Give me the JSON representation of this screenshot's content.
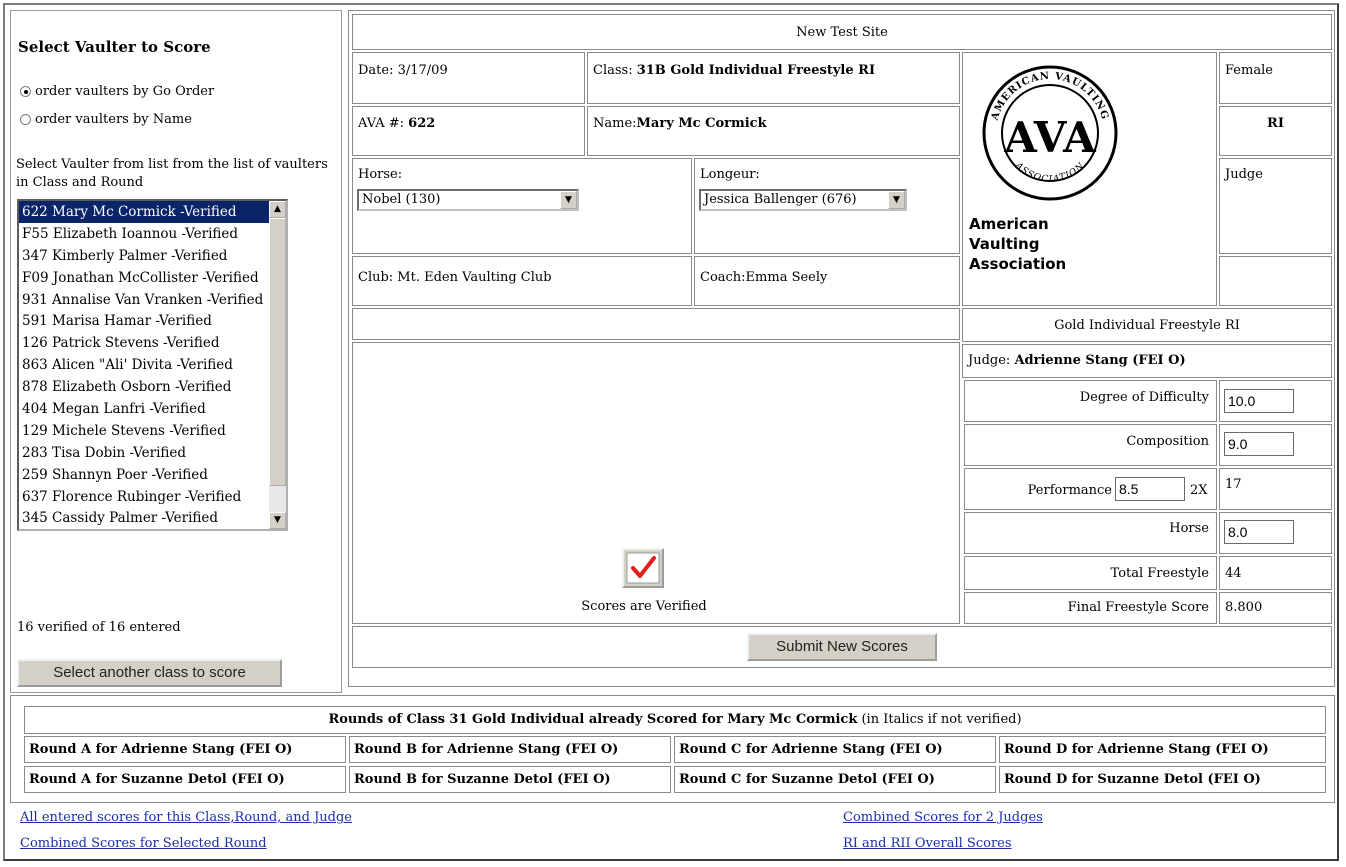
{
  "left": {
    "title": "Select Vaulter to Score",
    "order_by_go": "order vaulters by Go Order",
    "order_by_name": "order vaulters by Name",
    "instruction": "Select Vaulter from list from the list of vaulters in Class and Round",
    "vaulters": [
      "622 Mary Mc Cormick -Verified",
      "F55 Elizabeth Ioannou -Verified",
      "347 Kimberly Palmer -Verified",
      "F09 Jonathan McCollister -Verified",
      "931 Annalise Van Vranken -Verified",
      "591 Marisa Hamar -Verified",
      "126 Patrick Stevens -Verified",
      "863 Alicen \"Ali' Divita -Verified",
      "878 Elizabeth Osborn -Verified",
      "404 Megan Lanfri -Verified",
      "129 Michele Stevens -Verified",
      "283 Tisa Dobin -Verified",
      "259 Shannyn Poer -Verified",
      "637 Florence Rubinger -Verified",
      "345 Cassidy Palmer -Verified"
    ],
    "verified_count": "16 verified of 16 entered",
    "select_class_button": "Select another class to score"
  },
  "main": {
    "site": "New Test Site",
    "date_label": "Date: 3/17/09",
    "class_label": "Class: ",
    "class_value": "31B Gold Individual Freestyle RI",
    "ava_label": "AVA #: ",
    "ava_value": "622",
    "name_label": "Name:",
    "name_value": "Mary Mc Cormick",
    "horse_label": "Horse:",
    "horse_value": "Nobel (130)",
    "longeur_label": "Longeur:",
    "longeur_value": "Jessica Ballenger (676)",
    "club": "Club: Mt. Eden Vaulting Club",
    "coach": "Coach:Emma Seely",
    "gender": "Female",
    "level": "RI",
    "judge_label": "Judge",
    "org_line1": "American",
    "org_line2": "Vaulting",
    "org_line3": "Association",
    "logo_text_top": "AMERICAN VAULTING",
    "logo_text_bottom": "ASSOCIATION",
    "logo_letters": "AVA",
    "class_name": "Gold Individual Freestyle RI",
    "judge_prefix": "Judge: ",
    "judge_name": "Adrienne Stang (FEI O)",
    "verified_text": "Scores are Verified",
    "submit_button": "Submit New Scores"
  },
  "scores": {
    "difficulty_label": "Degree of Difficulty",
    "difficulty_value": "10.0",
    "composition_label": "Composition",
    "composition_value": "9.0",
    "performance_label": "Performance",
    "performance_value": "8.5",
    "performance_mult": "2X",
    "performance_total": "17",
    "horse_label": "Horse",
    "horse_value": "8.0",
    "total_label": "Total Freestyle",
    "total_value": "44",
    "final_label": "Final Freestyle Score",
    "final_value": "8.800"
  },
  "rounds": {
    "header_bold": "Rounds of Class 31 Gold Individual already Scored for Mary Mc Cormick",
    "header_note": " (in Italics if not verified)",
    "row1": [
      "Round A for Adrienne Stang (FEI O)",
      "Round B for Adrienne Stang (FEI O)",
      "Round C for Adrienne Stang (FEI O)",
      "Round D for Adrienne Stang (FEI O)"
    ],
    "row2": [
      "Round A for Suzanne Detol (FEI O)",
      "Round B for Suzanne Detol (FEI O)",
      "Round C for Suzanne Detol (FEI O)",
      "Round D for Suzanne Detol (FEI O)"
    ]
  },
  "links": {
    "all_scores": "All entered scores for this Class,Round, and Judge",
    "combined_round": "Combined Scores for Selected Round",
    "combined_judges": "Combined Scores for 2 Judges",
    "overall": "RI and RII Overall Scores"
  },
  "colors": {
    "selection": "#0a246a",
    "link": "#1a2ea8",
    "check": "#e0201e",
    "button_face": "#d4d0c8"
  }
}
